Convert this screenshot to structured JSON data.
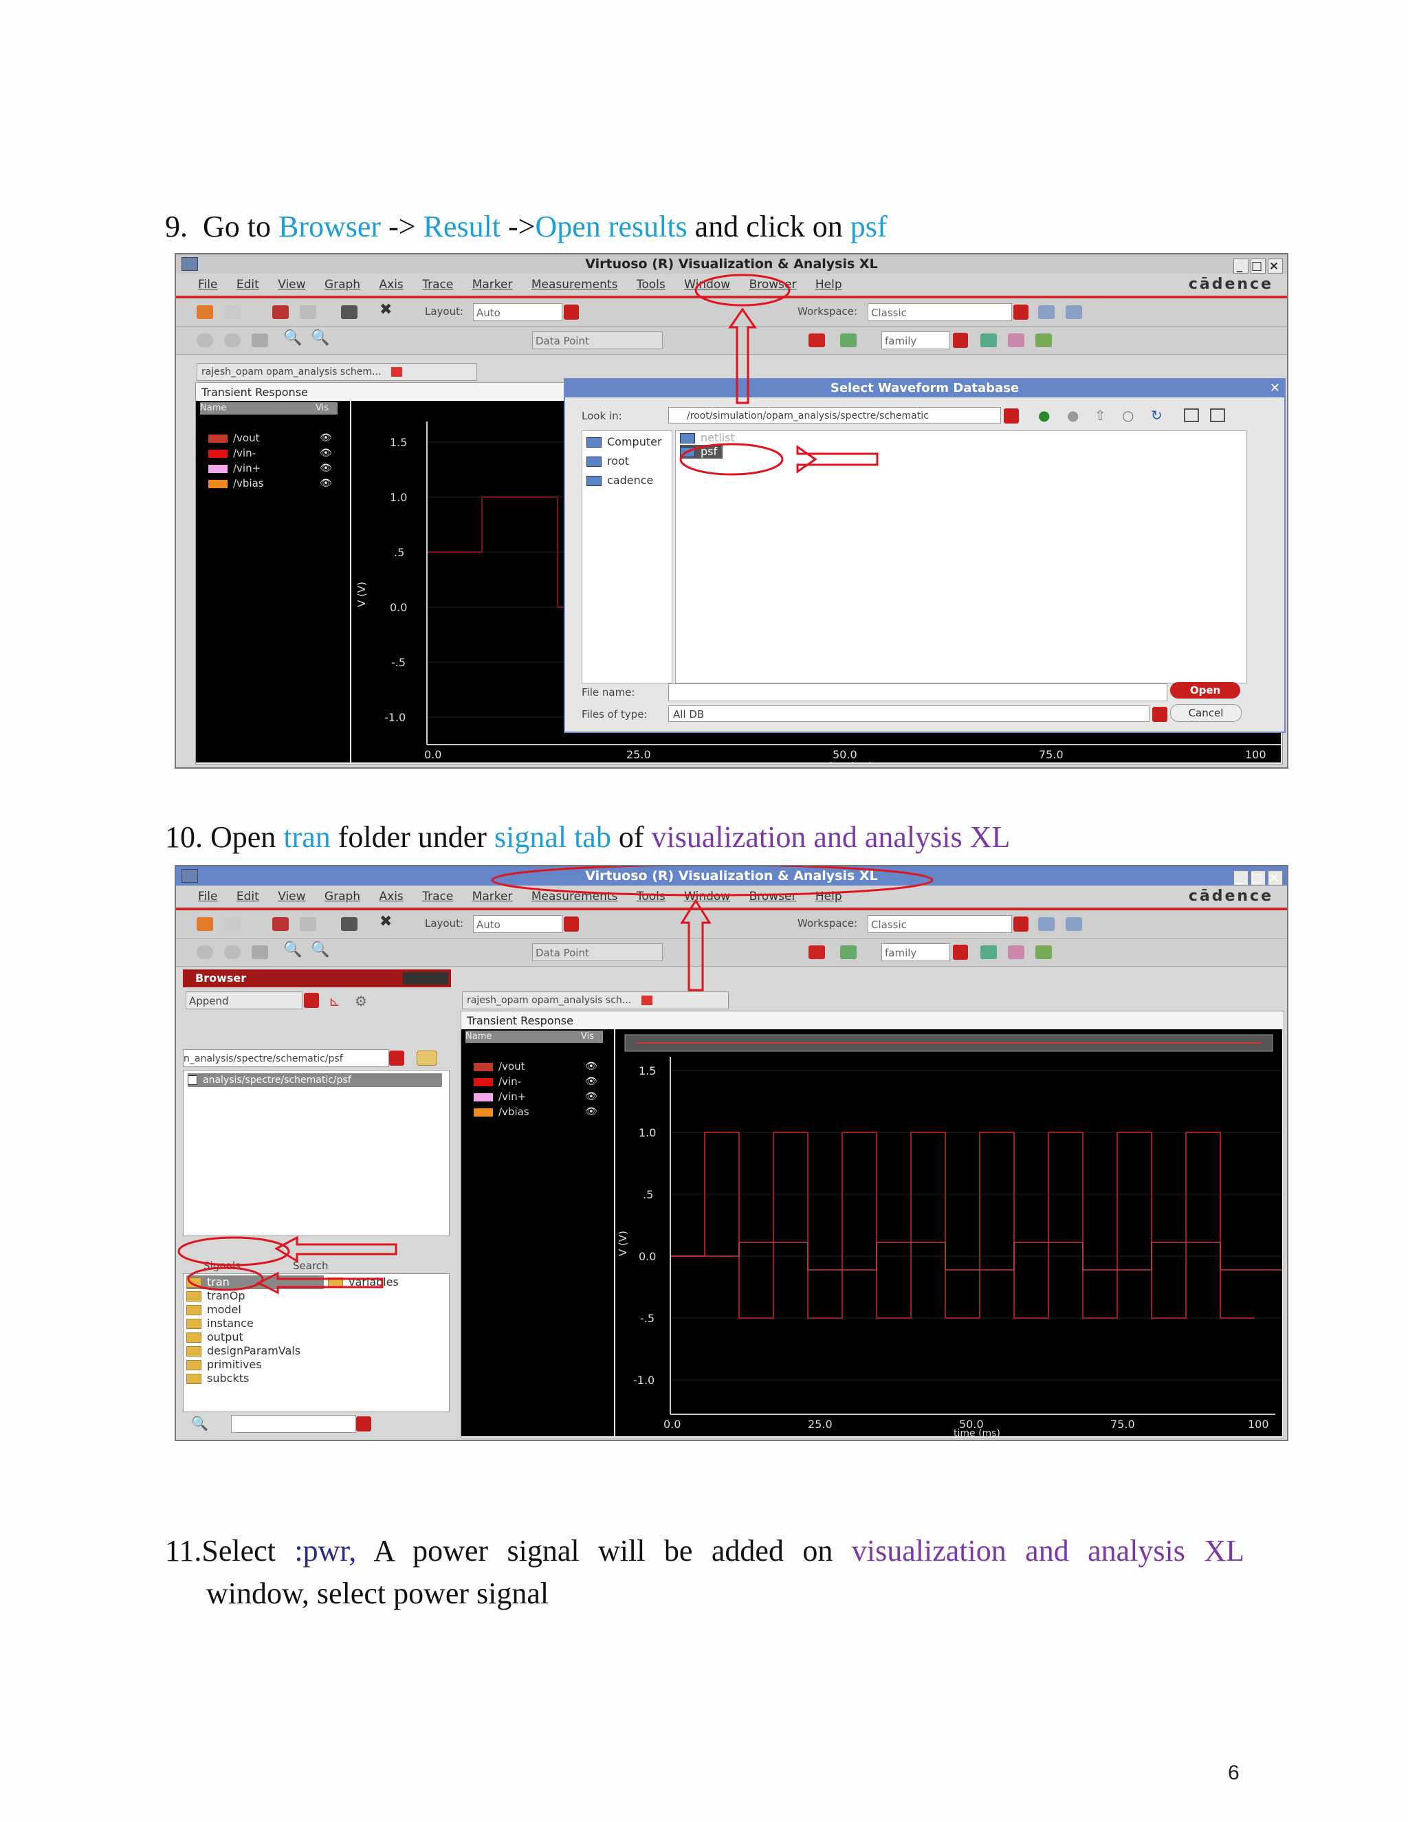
{
  "step9": {
    "number": "9.",
    "pre": "Go to",
    "browser": "Browser",
    "arrow1": "->",
    "result": "Result",
    "arrow2": "->",
    "open_results": "Open results",
    "mid": "and click on",
    "psf": "psf"
  },
  "step10": {
    "number": "10.",
    "pre": "Open",
    "tran": "tran",
    "mid": "folder under",
    "signal_tab": "signal tab",
    "of": "of",
    "app": "visualization and analysis XL"
  },
  "step11": {
    "number": "11.",
    "select": "Select",
    "pwr": ":pwr,",
    "mid": "A power signal will be added on",
    "app": "visualization and analysis XL",
    "line2": "window, select power signal"
  },
  "window": {
    "title": "Virtuoso (R) Visualization & Analysis XL",
    "brand": "cādence",
    "menu": [
      "File",
      "Edit",
      "View",
      "Graph",
      "Axis",
      "Trace",
      "Marker",
      "Measurements",
      "Tools",
      "Window",
      "Browser",
      "Help"
    ],
    "layout_label": "Layout:",
    "layout_value": "Auto",
    "workspace_label": "Workspace:",
    "workspace_value": "Classic",
    "data_point": "Data Point",
    "family": "family",
    "tab_label": "rajesh_opam opam_analysis schem...",
    "tab_label2": "rajesh_opam opam_analysis sch...",
    "plot_title": "Transient Response",
    "legend_header_name": "Name",
    "legend_header_vis": "Vis",
    "signals": [
      {
        "name": "/vout",
        "color": "#c0392b"
      },
      {
        "name": "/vin-",
        "color": "#e01010"
      },
      {
        "name": "/vin+",
        "color": "#f2a8e6"
      },
      {
        "name": "/vbias",
        "color": "#f08a1e"
      }
    ],
    "y_axis_label": "V (V)",
    "y_ticks": [
      "1.5",
      "1.0",
      ".5",
      "0.0",
      "-.5",
      "-1.0"
    ],
    "x_ticks": [
      "0.0",
      "25.0",
      "50.0",
      "75.0",
      "100"
    ],
    "x_axis_label": "time (ms)"
  },
  "dialog": {
    "title": "Select Waveform Database",
    "look_in_label": "Look in:",
    "look_in_value": "/root/simulation/opam_analysis/spectre/schematic",
    "places": [
      "Computer",
      "root",
      "cadence"
    ],
    "files": [
      "netlist",
      "psf"
    ],
    "file_name_label": "File name:",
    "files_of_type_label": "Files of type:",
    "files_of_type_value": "All DB",
    "open_button": "Open",
    "cancel_button": "Cancel"
  },
  "browser_panel": {
    "title": "Browser",
    "append": "Append",
    "path_combo": "n_analysis/spectre/schematic/psf",
    "tree_item": "analysis/spectre/schematic/psf",
    "tab_signals": "Signals",
    "tab_search": "Search",
    "folders": [
      "tran",
      "tranOp",
      "model",
      "instance",
      "output",
      "designParamVals",
      "primitives",
      "subckts"
    ],
    "variables": "variables"
  },
  "page_number": "6"
}
